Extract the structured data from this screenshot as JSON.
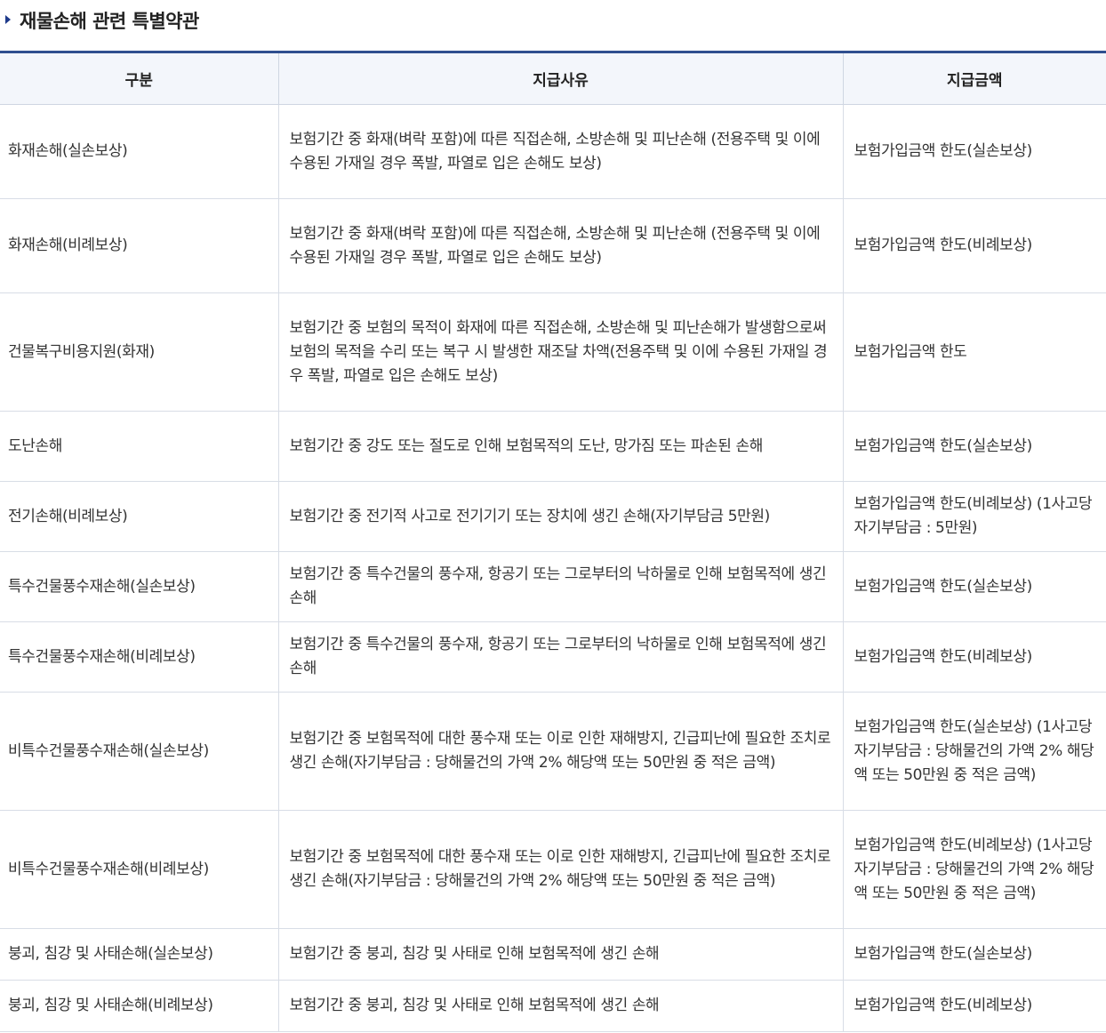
{
  "title": "재물손해 관련 특별약관",
  "headers": [
    "구분",
    "지급사유",
    "지급금액"
  ],
  "rows": [
    {
      "category": "화재손해(실손보상)",
      "reason": "보험기간 중 화재(벼락 포함)에 따른 직접손해, 소방손해 및 피난손해 (전용주택 및 이에 수용된 가재일 경우 폭발, 파열로 입은 손해도 보상)",
      "amount": "보험가입금액 한도(실손보상)"
    },
    {
      "category": "화재손해(비례보상)",
      "reason": "보험기간 중 화재(벼락 포함)에 따른 직접손해, 소방손해 및 피난손해 (전용주택 및 이에 수용된 가재일 경우 폭발, 파열로 입은 손해도 보상)",
      "amount": "보험가입금액 한도(비례보상)"
    },
    {
      "category": "건물복구비용지원(화재)",
      "reason": "보험기간 중 보험의 목적이 화재에 따른 직접손해, 소방손해 및 피난손해가 발생함으로써 보험의 목적을 수리 또는 복구 시 발생한 재조달 차액(전용주택 및 이에 수용된 가재일 경우 폭발, 파열로 입은 손해도 보상)",
      "amount": "보험가입금액 한도"
    },
    {
      "category": "도난손해",
      "reason": "보험기간 중 강도 또는 절도로 인해 보험목적의 도난, 망가짐 또는 파손된 손해",
      "amount": "보험가입금액 한도(실손보상)"
    },
    {
      "category": "전기손해(비례보상)",
      "reason": "보험기간 중 전기적 사고로 전기기기 또는 장치에 생긴 손해(자기부담금 5만원)",
      "amount": "보험가입금액 한도(비례보상) (1사고당 자기부담금 : 5만원)"
    },
    {
      "category": "특수건물풍수재손해(실손보상)",
      "reason": "보험기간 중 특수건물의 풍수재, 항공기 또는 그로부터의 낙하물로 인해 보험목적에 생긴 손해",
      "amount": "보험가입금액 한도(실손보상)"
    },
    {
      "category": "특수건물풍수재손해(비례보상)",
      "reason": "보험기간 중 특수건물의 풍수재, 항공기 또는 그로부터의 낙하물로 인해 보험목적에 생긴 손해",
      "amount": "보험가입금액 한도(비례보상)"
    },
    {
      "category": "비특수건물풍수재손해(실손보상)",
      "reason": "보험기간 중 보험목적에 대한 풍수재 또는 이로 인한 재해방지, 긴급피난에 필요한 조치로 생긴 손해(자기부담금 : 당해물건의 가액 2% 해당액 또는 50만원 중 적은 금액)",
      "amount": "보험가입금액 한도(실손보상) (1사고당 자기부담금 : 당해물건의 가액 2% 해당액 또는 50만원 중 적은 금액)"
    },
    {
      "category": "비특수건물풍수재손해(비례보상)",
      "reason": "보험기간 중 보험목적에 대한 풍수재 또는 이로 인한 재해방지, 긴급피난에 필요한 조치로 생긴 손해(자기부담금 : 당해물건의 가액 2% 해당액 또는 50만원 중 적은 금액)",
      "amount": "보험가입금액 한도(비례보상) (1사고당 자기부담금 : 당해물건의 가액 2% 해당액 또는 50만원 중 적은 금액)"
    },
    {
      "category": "붕괴, 침강 및 사태손해(실손보상)",
      "reason": "보험기간 중 붕괴, 침강 및 사태로 인해 보험목적에 생긴 손해",
      "amount": "보험가입금액 한도(실손보상)"
    },
    {
      "category": "붕괴, 침강 및 사태손해(비례보상)",
      "reason": "보험기간 중 붕괴, 침강 및 사태로 인해 보험목적에 생긴 손해",
      "amount": "보험가입금액 한도(비례보상)"
    }
  ]
}
